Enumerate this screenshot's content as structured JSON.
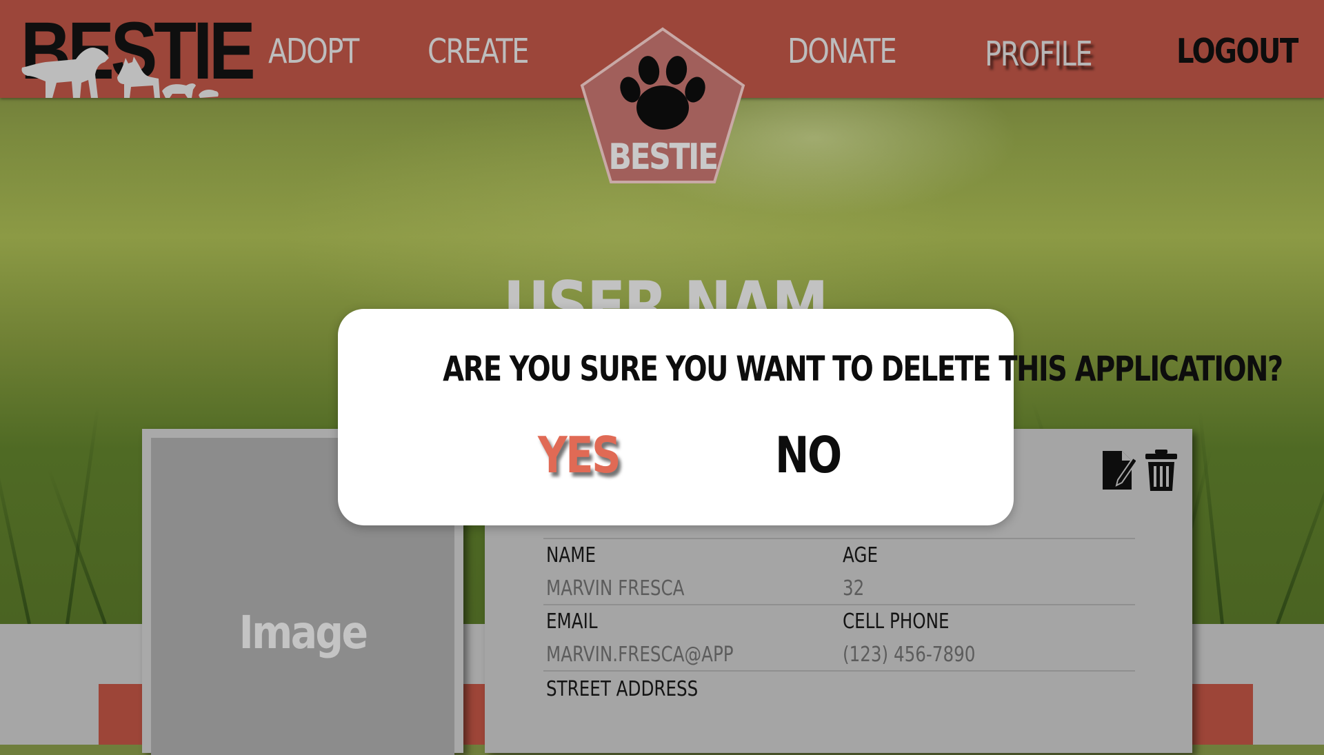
{
  "header": {
    "brand": "BESTIE",
    "nav": {
      "adopt": "ADOPT",
      "create": "CREATE",
      "donate": "DONATE",
      "profile": "PROFILE",
      "logout": "LOGOUT"
    },
    "badge_label": "BESTIE",
    "badge_icon": "paw-icon"
  },
  "profile": {
    "username": "USER NAME",
    "image_label": "Image",
    "fields": {
      "name_label": "NAME",
      "name_value": "MARVIN FRESCA",
      "age_label": "AGE",
      "age_value": "32",
      "email_label": "EMAIL",
      "email_value": "MARVIN.FRESCA@APP",
      "phone_label": "CELL PHONE",
      "phone_value": "(123) 456-7890",
      "address_label": "STREET ADDRESS"
    },
    "actions": {
      "edit_icon": "edit-document-icon",
      "delete_icon": "trash-icon"
    }
  },
  "modal": {
    "question": "ARE YOU SURE YOU WANT TO DELETE THIS APPLICATION?",
    "yes": "YES",
    "no": "NO"
  },
  "colors": {
    "header": "#9c463a",
    "accent_yes": "#e06a55",
    "modal_bg": "#ffffff",
    "card": "#a5a5a5"
  }
}
